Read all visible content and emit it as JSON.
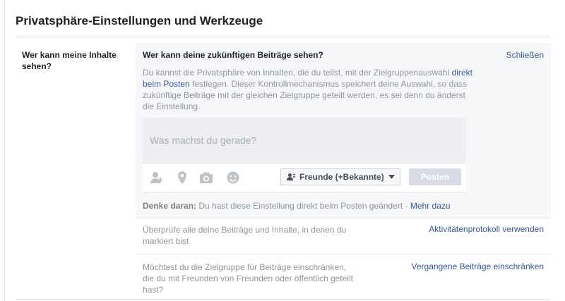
{
  "page": {
    "title": "Privatsphäre-Einstellungen und Werkzeuge"
  },
  "section": {
    "left_label": "Wer kann meine Inhalte sehen?",
    "heading": "Wer kann deine zukünftigen Beiträge sehen?",
    "close_label": "Schließen",
    "description_before": "Du kannst die Privatsphäre von Inhalten, die du teilst, mit der Zielgruppenauswahl ",
    "description_link": "direkt beim Posten",
    "description_after": " festlegen. Dieser Kontrollmechanismus speichert deine Auswahl, so dass zukünftige Beiträge mit der gleichen Zielgruppe geteilt werden, es sei denn du änderst die Einstellung."
  },
  "composer": {
    "placeholder": "Was machst du gerade?",
    "audience_label": "Freunde (+Bekannte)",
    "post_label": "Posten",
    "icons": [
      "tag-friends-icon",
      "location-icon",
      "camera-icon",
      "feeling-icon"
    ]
  },
  "reminder": {
    "prefix": "Denke daran:",
    "text": " Du hast diese Einstellung direkt beim Posten geändert · ",
    "more_label": "Mehr dazu"
  },
  "rows": [
    {
      "text": "Überprüfe alle deine Beiträge und Inhalte, in denen du markiert bist",
      "action": "Aktivitätenprotokoll verwenden"
    },
    {
      "text": "Möchtest du die Zielgruppe für Beiträge einschränken, die du mit Freunden von Freunden oder öffentlich geteilt hast?",
      "action": "Vergangene Beiträge einschränken"
    }
  ],
  "colors": {
    "link": "#365899",
    "muted": "#90949c",
    "panel_bg": "#f6f7f9",
    "icon": "#bec3c9"
  }
}
